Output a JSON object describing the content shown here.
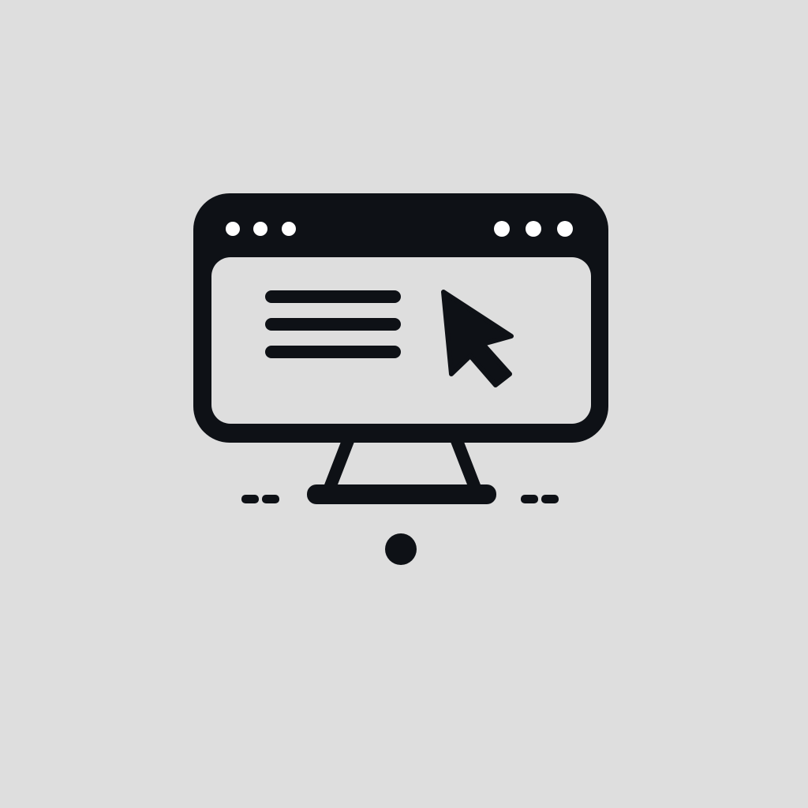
{
  "illustration": {
    "icon": "computer-monitor-with-browser-window-icon",
    "elements": {
      "title_bar": "browser-title-bar",
      "window_controls_left": [
        "dot",
        "dot",
        "dot"
      ],
      "window_controls_right": [
        "dot",
        "dot",
        "dot"
      ],
      "content": "text-lines-icon",
      "cursor": "mouse-pointer-icon",
      "stand": "monitor-stand",
      "indicator": "dot"
    },
    "text_line_count": 3,
    "colors": {
      "background": "#dedede",
      "stroke": "#0e1116",
      "screen": "#dedede",
      "dot": "#ffffff"
    }
  }
}
